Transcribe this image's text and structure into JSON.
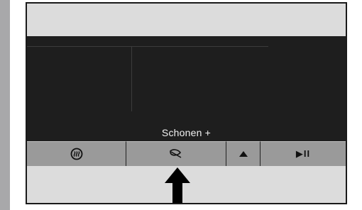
{
  "screen": {
    "mode_label": "Schonen +"
  },
  "buttons": {
    "heat_icon": "heat-steam-icon",
    "leaf_icon": "leaf-icon",
    "up_icon": "triangle-up-icon",
    "play_pause_label": "▶II"
  },
  "indicator": {
    "icon": "arrow-up-icon",
    "points_to": "leaf-button"
  },
  "colors": {
    "screen_background": "#1e1e1e",
    "button_background": "#9a9a9a",
    "panel_background": "#dcdcdc",
    "arrow": "#000000"
  }
}
